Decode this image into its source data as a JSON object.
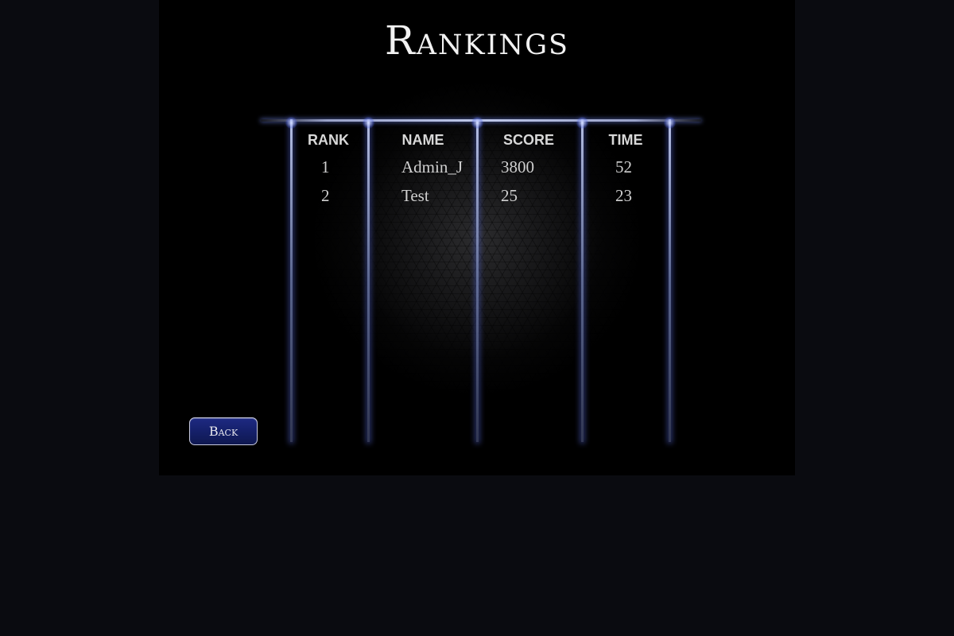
{
  "title": "Rankings",
  "table": {
    "columns": [
      "RANK",
      "NAME",
      "SCORE",
      "TIME"
    ],
    "rows": [
      {
        "rank": "1",
        "name": "Admin_J",
        "score": "3800",
        "time": "52"
      },
      {
        "rank": "2",
        "name": "Test",
        "score": "25",
        "time": "23"
      }
    ]
  },
  "back_button": {
    "label": "Back"
  },
  "colors": {
    "page_background": "#0a0b10",
    "panel_background": "#000000",
    "button_fill": "#15206a",
    "pillar_glow": "#5a6ee6"
  }
}
